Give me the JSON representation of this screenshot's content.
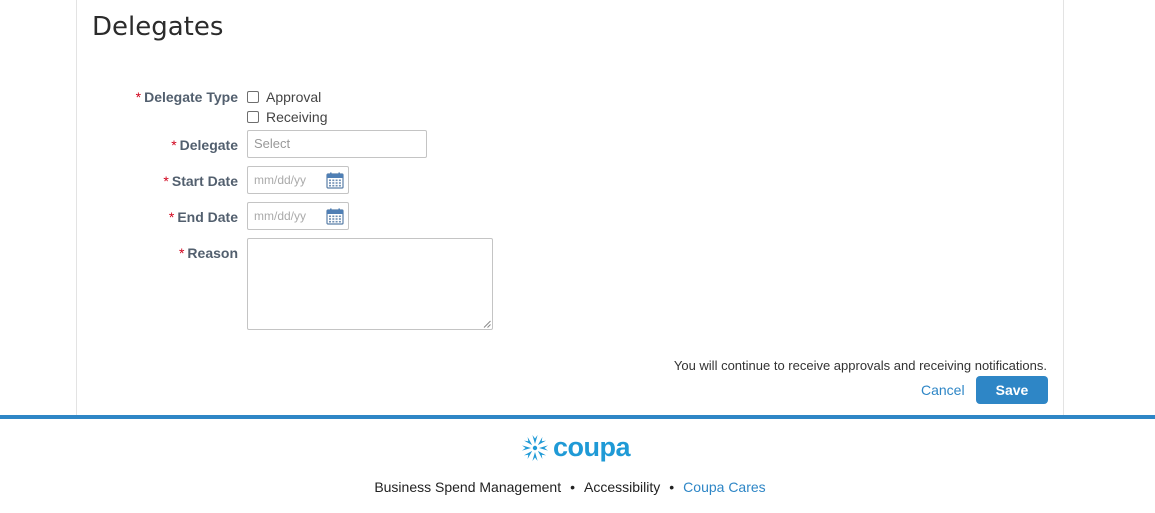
{
  "page": {
    "title": "Delegates"
  },
  "form": {
    "delegate_type": {
      "label": "Delegate Type",
      "options": [
        {
          "label": "Approval",
          "checked": false
        },
        {
          "label": "Receiving",
          "checked": false
        }
      ]
    },
    "delegate": {
      "label": "Delegate",
      "placeholder": "Select"
    },
    "start_date": {
      "label": "Start Date",
      "placeholder": "mm/dd/yy"
    },
    "end_date": {
      "label": "End Date",
      "placeholder": "mm/dd/yy"
    },
    "reason": {
      "label": "Reason",
      "value": ""
    },
    "required_marker": "*"
  },
  "actions": {
    "notice": "You will continue to receive approvals and receiving notifications.",
    "cancel_label": "Cancel",
    "save_label": "Save"
  },
  "footer": {
    "logo_text": "coupa",
    "links": [
      "Business Spend Management",
      "Accessibility",
      "Coupa Cares"
    ],
    "separator": "•"
  },
  "colors": {
    "accent": "#2e86c6",
    "logo": "#1f9ad6",
    "required": "#d0021b"
  },
  "icons": {
    "date_picker": "calendar-icon",
    "brand": "coupa-logo-icon"
  }
}
